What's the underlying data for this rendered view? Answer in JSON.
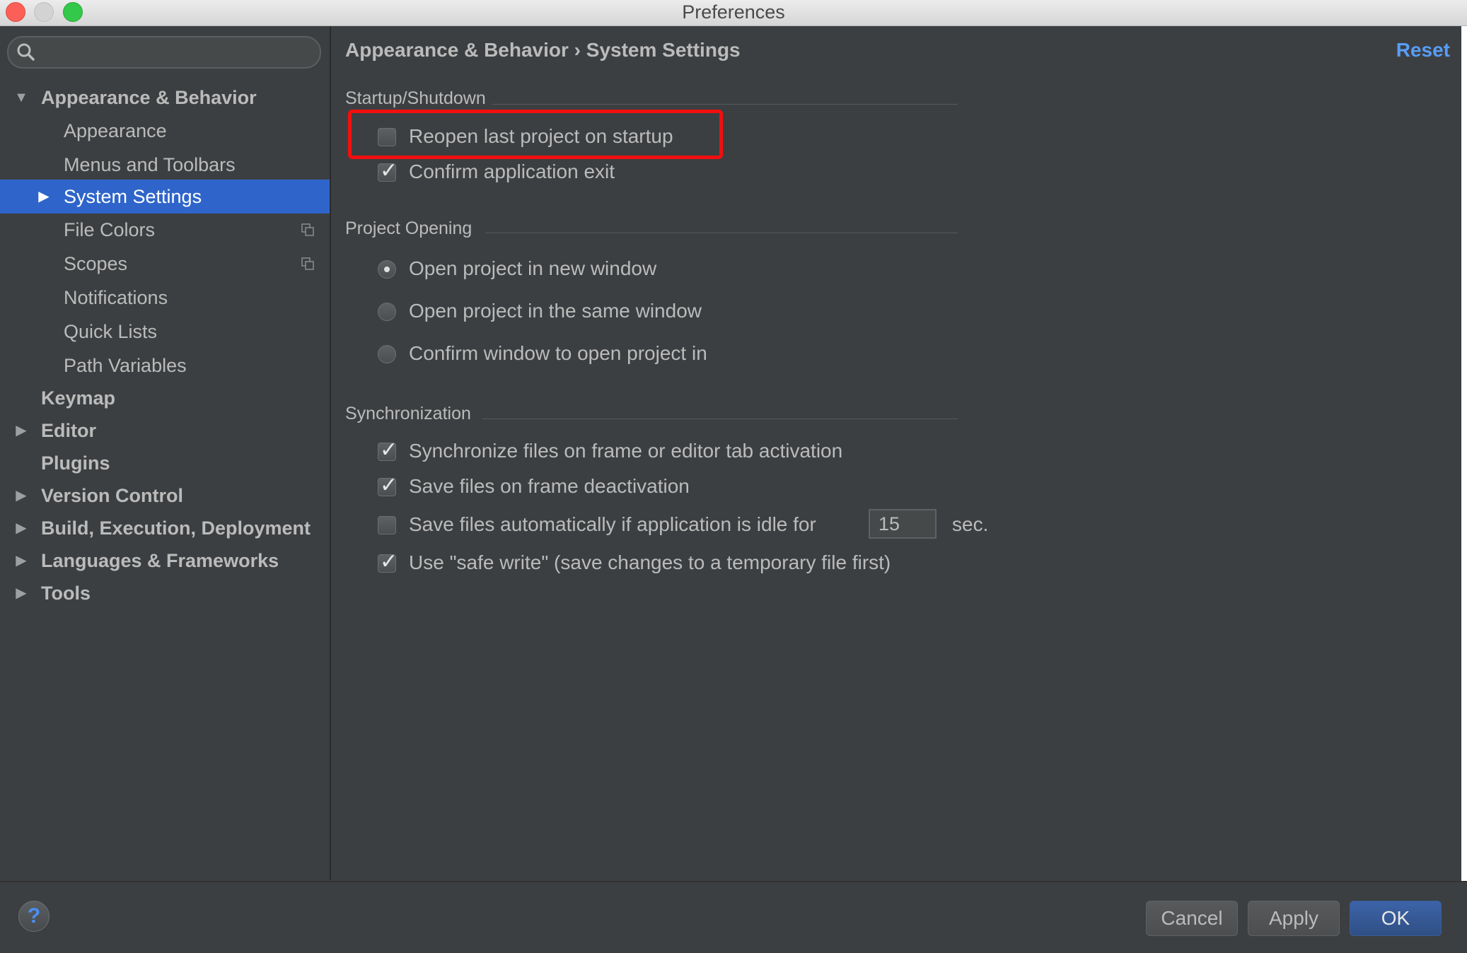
{
  "window": {
    "title": "Preferences"
  },
  "search": {
    "placeholder": ""
  },
  "sidebar": {
    "items": [
      {
        "label": "Appearance & Behavior",
        "level": 0,
        "expanded": true,
        "bold": true
      },
      {
        "label": "Appearance",
        "level": 1
      },
      {
        "label": "Menus and Toolbars",
        "level": 1
      },
      {
        "label": "System Settings",
        "level": 1,
        "selected": true,
        "has_children": true
      },
      {
        "label": "File Colors",
        "level": 1,
        "copy_icon": true
      },
      {
        "label": "Scopes",
        "level": 1,
        "copy_icon": true
      },
      {
        "label": "Notifications",
        "level": 1
      },
      {
        "label": "Quick Lists",
        "level": 1
      },
      {
        "label": "Path Variables",
        "level": 1
      },
      {
        "label": "Keymap",
        "level": 0,
        "bold": true
      },
      {
        "label": "Editor",
        "level": 0,
        "bold": true,
        "has_children": true
      },
      {
        "label": "Plugins",
        "level": 0,
        "bold": true
      },
      {
        "label": "Version Control",
        "level": 0,
        "bold": true,
        "has_children": true
      },
      {
        "label": "Build, Execution, Deployment",
        "level": 0,
        "bold": true,
        "has_children": true
      },
      {
        "label": "Languages & Frameworks",
        "level": 0,
        "bold": true,
        "has_children": true
      },
      {
        "label": "Tools",
        "level": 0,
        "bold": true,
        "has_children": true
      }
    ]
  },
  "content": {
    "breadcrumb": "Appearance & Behavior › System Settings",
    "reset_label": "Reset",
    "startup": {
      "title": "Startup/Shutdown",
      "reopen_last_project": {
        "label": "Reopen last project on startup",
        "checked": false
      },
      "confirm_exit": {
        "label": "Confirm application exit",
        "checked": true
      }
    },
    "project_opening": {
      "title": "Project Opening",
      "options": [
        {
          "label": "Open project in new window",
          "selected": true
        },
        {
          "label": "Open project in the same window",
          "selected": false
        },
        {
          "label": "Confirm window to open project in",
          "selected": false
        }
      ]
    },
    "sync": {
      "title": "Synchronization",
      "sync_files": {
        "label": "Synchronize files on frame or editor tab activation",
        "checked": true
      },
      "save_on_deactivation": {
        "label": "Save files on frame deactivation",
        "checked": true
      },
      "save_idle": {
        "label": "Save files automatically if application is idle for",
        "checked": false,
        "value": "15",
        "unit": "sec."
      },
      "safe_write": {
        "label": "Use \"safe write\" (save changes to a temporary file first)",
        "checked": true
      }
    }
  },
  "footer": {
    "help_label": "?",
    "cancel_label": "Cancel",
    "apply_label": "Apply",
    "ok_label": "OK"
  },
  "colors": {
    "background": "#3c3f41",
    "selection": "#2f65ca",
    "accent_link": "#589df6",
    "highlight_box": "#f20f0f"
  }
}
